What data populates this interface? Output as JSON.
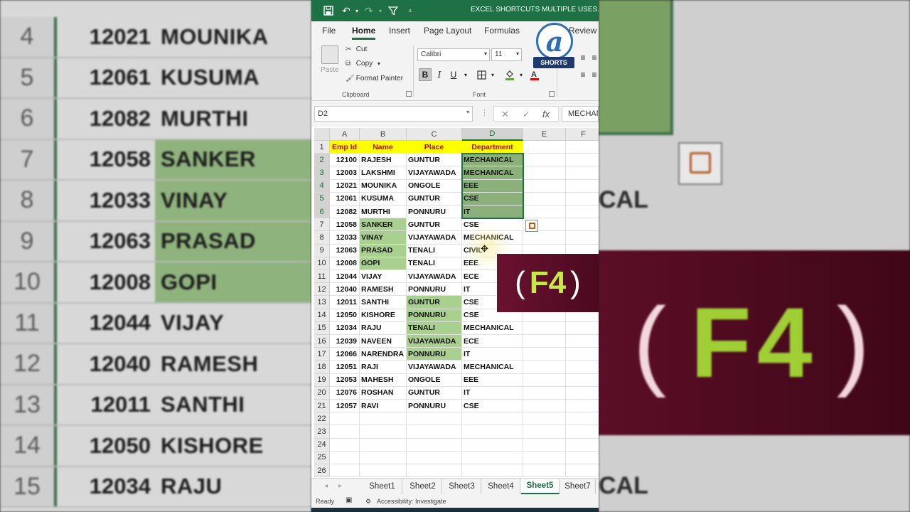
{
  "window": {
    "title": "EXCEL SHORTCUTS MULTIPLE USES.xlsx"
  },
  "menu": {
    "tabs": [
      "File",
      "Home",
      "Insert",
      "Page Layout",
      "Formulas",
      "Review"
    ],
    "active": "Home"
  },
  "ribbon": {
    "clipboard": {
      "paste": "Paste",
      "cut": "Cut",
      "copy": "Copy",
      "format_painter": "Format Painter",
      "group_label": "Clipboard"
    },
    "font": {
      "name": "Calibri",
      "size": "11",
      "group_label": "Font",
      "bold": "B",
      "italic": "I",
      "underline": "U"
    }
  },
  "logo": {
    "letter": "a",
    "badge": "SHORTS"
  },
  "formula_bar": {
    "name_box": "D2",
    "value": "MECHANICAL",
    "cancel": "✕",
    "enter": "✓",
    "fx": "fx"
  },
  "sheet": {
    "columns": [
      "A",
      "B",
      "C",
      "D",
      "E",
      "F"
    ],
    "selected_column": "D",
    "header": [
      "Emp Id",
      "Name",
      "Place",
      "Department"
    ],
    "rows": [
      [
        "12100",
        "RAJESH",
        "GUNTUR",
        "MECHANICAL"
      ],
      [
        "12003",
        "LAKSHMI",
        "VIJAYAWADA",
        "MECHANICAL"
      ],
      [
        "12021",
        "MOUNIKA",
        "ONGOLE",
        "EEE"
      ],
      [
        "12061",
        "KUSUMA",
        "GUNTUR",
        "CSE"
      ],
      [
        "12082",
        "MURTHI",
        "PONNURU",
        "IT"
      ],
      [
        "12058",
        "SANKER",
        "GUNTUR",
        "CSE"
      ],
      [
        "12033",
        "VINAY",
        "VIJAYAWADA",
        "MECHANICAL"
      ],
      [
        "12063",
        "PRASAD",
        "TENALI",
        "CIVIL"
      ],
      [
        "12008",
        "GOPI",
        "TENALI",
        "EEE"
      ],
      [
        "12044",
        "VIJAY",
        "VIJAYAWADA",
        "ECE"
      ],
      [
        "12040",
        "RAMESH",
        "PONNURU",
        "IT"
      ],
      [
        "12011",
        "SANTHI",
        "GUNTUR",
        "CSE"
      ],
      [
        "12050",
        "KISHORE",
        "PONNURU",
        "CSE"
      ],
      [
        "12034",
        "RAJU",
        "TENALI",
        "MECHANICAL"
      ],
      [
        "12039",
        "NAVEEN",
        "VIJAYAWADA",
        "ECE"
      ],
      [
        "12066",
        "NARENDRA",
        "PONNURU",
        "IT"
      ],
      [
        "12051",
        "RAJI",
        "VIJAYAWADA",
        "MECHANICAL"
      ],
      [
        "12053",
        "MAHESH",
        "ONGOLE",
        "EEE"
      ],
      [
        "12076",
        "ROSHAN",
        "GUNTUR",
        "IT"
      ],
      [
        "12057",
        "RAVI",
        "PONNURU",
        "CSE"
      ]
    ],
    "row_numbers": [
      "1",
      "2",
      "3",
      "4",
      "5",
      "6",
      "7",
      "8",
      "9",
      "10",
      "11",
      "12",
      "13",
      "14",
      "15",
      "16",
      "17",
      "18",
      "19",
      "20",
      "21",
      "22",
      "23",
      "24",
      "25",
      "26"
    ]
  },
  "shortcut_banner": {
    "open": "(",
    "key": "F4",
    "close": ")"
  },
  "sheet_tabs": [
    "Sheet1",
    "Sheet2",
    "Sheet3",
    "Sheet4",
    "Sheet5",
    "Sheet7"
  ],
  "active_sheet": "Sheet5",
  "status": {
    "ready": "Ready",
    "accessibility": "Accessibility: Investigate"
  },
  "background_zoom": {
    "rows": [
      {
        "num": "4",
        "id": "12021",
        "name": "MOUNIKA"
      },
      {
        "num": "5",
        "id": "12061",
        "name": "KUSUMA"
      },
      {
        "num": "6",
        "id": "12082",
        "name": "MURTHI"
      },
      {
        "num": "7",
        "id": "12058",
        "name": "SANKER"
      },
      {
        "num": "8",
        "id": "12033",
        "name": "VINAY"
      },
      {
        "num": "9",
        "id": "12063",
        "name": "PRASAD"
      },
      {
        "num": "10",
        "id": "12008",
        "name": "GOPI"
      },
      {
        "num": "11",
        "id": "12044",
        "name": "VIJAY"
      },
      {
        "num": "12",
        "id": "12040",
        "name": "RAMESH"
      },
      {
        "num": "13",
        "id": "12011",
        "name": "SANTHI"
      },
      {
        "num": "14",
        "id": "12050",
        "name": "KISHORE"
      },
      {
        "num": "15",
        "id": "12034",
        "name": "RAJU"
      }
    ],
    "right_text": [
      "CAL",
      "CAL"
    ]
  },
  "colors": {
    "excel_green": "#1e7145",
    "header_fill": "#ffff00",
    "header_text": "#c00000",
    "selected_fill": "#a9d08e",
    "banner": "#6a1230",
    "banner_key": "#c6e84a"
  }
}
